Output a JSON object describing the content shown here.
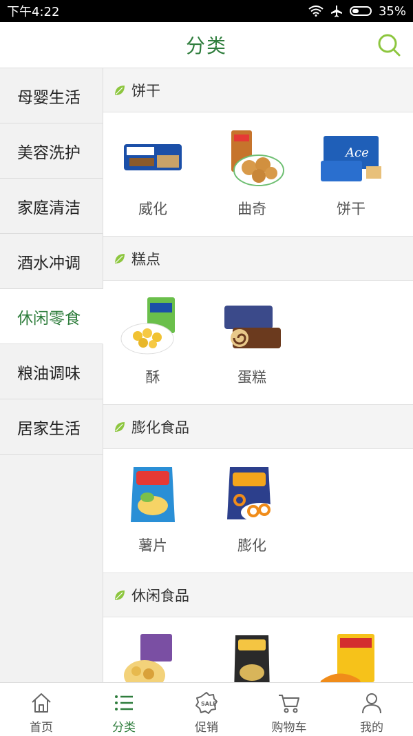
{
  "status": {
    "time": "下午4:22",
    "battery": "35%"
  },
  "header": {
    "title": "分类"
  },
  "sidebar": {
    "items": [
      {
        "label": "母婴生活"
      },
      {
        "label": "美容洗护"
      },
      {
        "label": "家庭清洁"
      },
      {
        "label": "酒水冲调"
      },
      {
        "label": "休闲零食"
      },
      {
        "label": "粮油调味"
      },
      {
        "label": "居家生活"
      }
    ],
    "active_index": 4
  },
  "sections": [
    {
      "title": "饼干",
      "products": [
        {
          "name": "威化"
        },
        {
          "name": "曲奇"
        },
        {
          "name": "饼干"
        }
      ]
    },
    {
      "title": "糕点",
      "products": [
        {
          "name": "酥"
        },
        {
          "name": "蛋糕"
        }
      ]
    },
    {
      "title": "膨化食品",
      "products": [
        {
          "name": "薯片"
        },
        {
          "name": "膨化"
        }
      ]
    },
    {
      "title": "休闲食品",
      "products": []
    }
  ],
  "tabbar": {
    "items": [
      {
        "label": "首页",
        "icon": "home-icon"
      },
      {
        "label": "分类",
        "icon": "category-list-icon"
      },
      {
        "label": "促销",
        "icon": "sale-tag-icon"
      },
      {
        "label": "购物车",
        "icon": "cart-icon"
      },
      {
        "label": "我的",
        "icon": "user-icon"
      }
    ],
    "active_index": 1
  },
  "colors": {
    "accent": "#2e7d3c",
    "leaf": "#8dc63f"
  }
}
